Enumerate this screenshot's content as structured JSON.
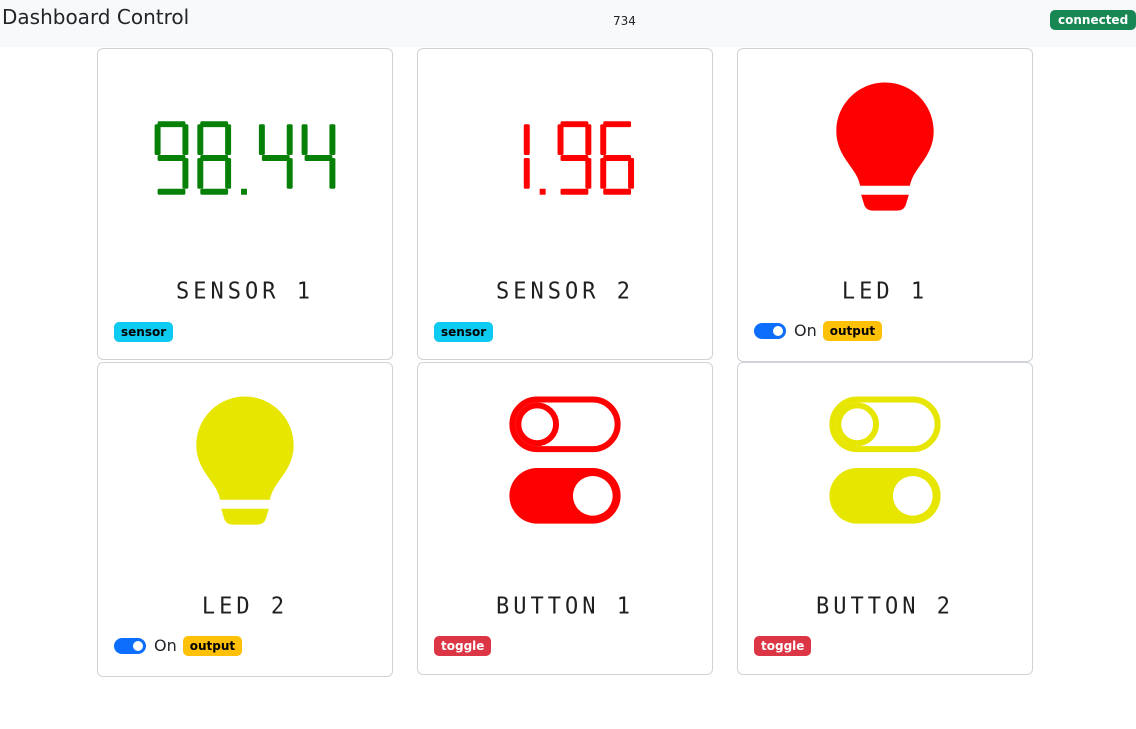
{
  "header": {
    "title": "Dashboard Control",
    "counter": "734",
    "status": "connected",
    "status_color": "#198754"
  },
  "widgets": [
    {
      "label": "SENSOR 1",
      "type": "sensor",
      "tag": "sensor",
      "value": "98.44",
      "color": "#068006"
    },
    {
      "label": "SENSOR 2",
      "type": "sensor",
      "tag": "sensor",
      "value": "1.96",
      "color": "#ff0000"
    },
    {
      "label": "LED 1",
      "type": "led",
      "tag": "output",
      "color": "#ff0000",
      "switch_label": "On",
      "switch_on": true
    },
    {
      "label": "LED 2",
      "type": "led",
      "tag": "output",
      "color": "#e6e600",
      "switch_label": "On",
      "switch_on": true
    },
    {
      "label": "BUTTON 1",
      "type": "button",
      "tag": "toggle",
      "color": "#ff0000"
    },
    {
      "label": "BUTTON 2",
      "type": "button",
      "tag": "toggle",
      "color": "#e6e600"
    }
  ]
}
